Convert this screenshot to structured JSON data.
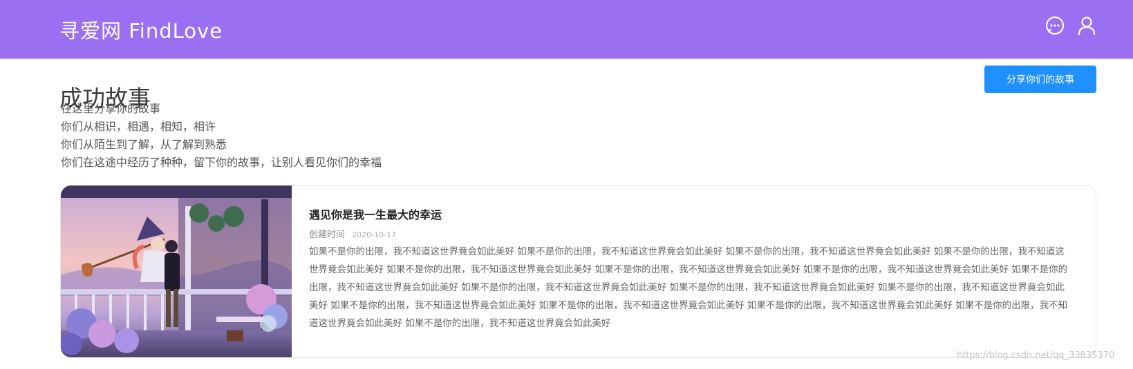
{
  "header": {
    "logo": "寻爱网 FindLove",
    "icons": [
      "chat-bubble-icon",
      "user-icon"
    ],
    "bg_color": "#9b6ff2"
  },
  "page": {
    "title": "成功故事",
    "share_button": "分享你们的故事",
    "intro_lines": [
      "在这里分享你的故事",
      "你们从相识，相遇，相知，相许",
      "你们从陌生到了解，从了解到熟悉",
      "你们在这途中经历了种种，留下你的故事，让别人看见你们的幸福"
    ]
  },
  "stories": [
    {
      "title": "遇见你是我一生最大的幸运",
      "created_label": "创建时间",
      "created_date": "2020-10-17",
      "excerpt": "如果不是你的出限，我不知道这世界竟会如此美好 如果不是你的出限，我不知道这世界竟会如此美好 如果不是你的出限，我不知道这世界竟会如此美好 如果不是你的出限，我不知道这世界竟会如此美好 如果不是你的出限，我不知道这世界竟会如此美好 如果不是你的出限，我不知道这世界竟会如此美好 如果不是你的出限，我不知道这世界竟会如此美好 如果不是你的出限，我不知道这世界竟会如此美好 如果不是你的出限，我不知道这世界竟会如此美好 如果不是你的出限，我不知道这世界竟会如此美好 如果不是你的出限，我不知道这世界竟会如此美好 如果不是你的出限，我不知道这世界竟会如此美好 如果不是你的出限，我不知道这世界竟会如此美好 如果不是你的出限，我不知道这世界竟会如此美好 如果不是你的出限，我不知道这世界竟会如此美好 如果不是你的出限，我不知道这世界竟会如此美好",
      "image": "balcony-couple-illustration"
    }
  ],
  "watermark": "https://blog.csdn.net/qq_33835370",
  "colors": {
    "accent": "#1e90ff",
    "header": "#9b6ff2"
  }
}
